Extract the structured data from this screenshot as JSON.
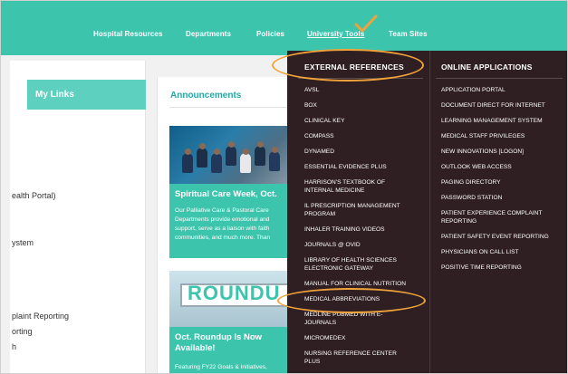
{
  "nav": {
    "items": [
      "Hospital Resources",
      "Departments",
      "Policies",
      "University Tools",
      "Team Sites"
    ],
    "active_index": 3
  },
  "left": {
    "tab_label": "My Links",
    "lines": [
      "ealth Portal)",
      "ystem",
      "plaint Reporting",
      "orting",
      "h"
    ]
  },
  "announcements": {
    "title": "Announcements",
    "card1": {
      "title": "Spiritual Care Week, Oct.",
      "body": [
        "Our Palliative Care & Pastoral Care",
        "Departments provide emotional and",
        "support, serve as a liaison with faith",
        "communities, and much more. Than"
      ]
    },
    "card2": {
      "image_text": "ROUNDU",
      "title": "Oct. Roundup Is Now Available!",
      "body": "Featuring FY22 Goals & Initiatives,"
    }
  },
  "mega": {
    "external_title": "EXTERNAL REFERENCES",
    "external_links": [
      "AVSL",
      "BOX",
      "CLINICAL KEY",
      "COMPASS",
      "DYNAMED",
      "ESSENTIAL EVIDENCE PLUS",
      "HARRISON'S TEXTBOOK OF INTERNAL MEDICINE",
      "IL PRESCRIPTION MANAGEMENT PROGRAM",
      "INHALER TRAINING VIDEOS",
      "JOURNALS @ OVID",
      "LIBRARY OF HEALTH SCIENCES ELECTRONIC GATEWAY",
      "MANUAL FOR CLINICAL NUTRITION",
      "MEDICAL ABBREVIATIONS",
      "MEDLINE PUBMED WITH E-JOURNALS",
      "MICROMEDEX",
      "NURSING REFERENCE CENTER PLUS"
    ],
    "online_title": "ONLINE APPLICATIONS",
    "online_links": [
      "APPLICATION PORTAL",
      "DOCUMENT DIRECT FOR INTERNET",
      "LEARNING MANAGEMENT SYSTEM",
      "MEDICAL STAFF PRIVILEGES",
      "NEW INNOVATIONS [LOGON]",
      "OUTLOOK WEB ACCESS",
      "PAGING DIRECTORY",
      "PASSWORD STATION",
      "PATIENT EXPERIENCE COMPLAINT REPORTING",
      "PATIENT SAFETY EVENT REPORTING",
      "PHYSICIANS ON CALL LIST",
      "POSITIVE TIME REPORTING"
    ]
  },
  "colors": {
    "nav_teal": "#3cc4ad",
    "menu_bg": "#2f1f22",
    "highlight_orange": "#f0a33a"
  }
}
